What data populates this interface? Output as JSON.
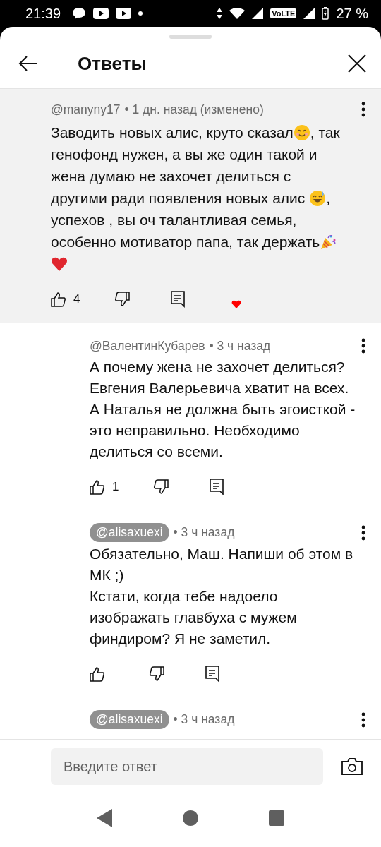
{
  "status_bar": {
    "time": "21:39",
    "network_label": "VoLTE",
    "battery": "27 %"
  },
  "header": {
    "title": "Ответы"
  },
  "comment": {
    "author": "@manyny17",
    "author_badge": false,
    "time": "• 1 дн. назад (изменено)",
    "creator_heart": true,
    "likes": "4",
    "text": [
      {
        "kind": "text",
        "text": "Заводить новых алис, круто сказал"
      },
      {
        "kind": "smile"
      },
      {
        "kind": "text",
        "text": ", так генофонд нужен, а вы же один такой и жена думаю не захочет делиться с другими ради появления новых алис "
      },
      {
        "kind": "sweat"
      },
      {
        "kind": "text",
        "text": ", успехов , вы оч талантливая семья, особенно мотиватор папа, так держать"
      },
      {
        "kind": "party"
      },
      {
        "kind": "heart"
      }
    ]
  },
  "replies": [
    {
      "author": "@ВалентинКубарев",
      "author_badge": false,
      "time": "• 3 ч назад",
      "likes": "1",
      "text": [
        {
          "kind": "text",
          "text": "А почему жена не захочет делиться? Евгения Валерьевича хватит на всех. А Наталья не должна быть эгоисткой - это неправильно. Необходимо делиться со всеми."
        }
      ]
    },
    {
      "author": "@alisaxuexi",
      "author_badge": true,
      "time": "• 3 ч назад",
      "text": [
        {
          "kind": "text",
          "text": "Обязательно, Маш. Напиши об этом в МК ;)\nКстати, когда тебе надоело изображать главбуха с мужем финдиром? Я не заметил."
        }
      ]
    },
    {
      "author": "@alisaxuexi",
      "author_badge": true,
      "time": "• 3 ч назад"
    }
  ],
  "reply_field": {
    "placeholder": "Введите ответ"
  }
}
